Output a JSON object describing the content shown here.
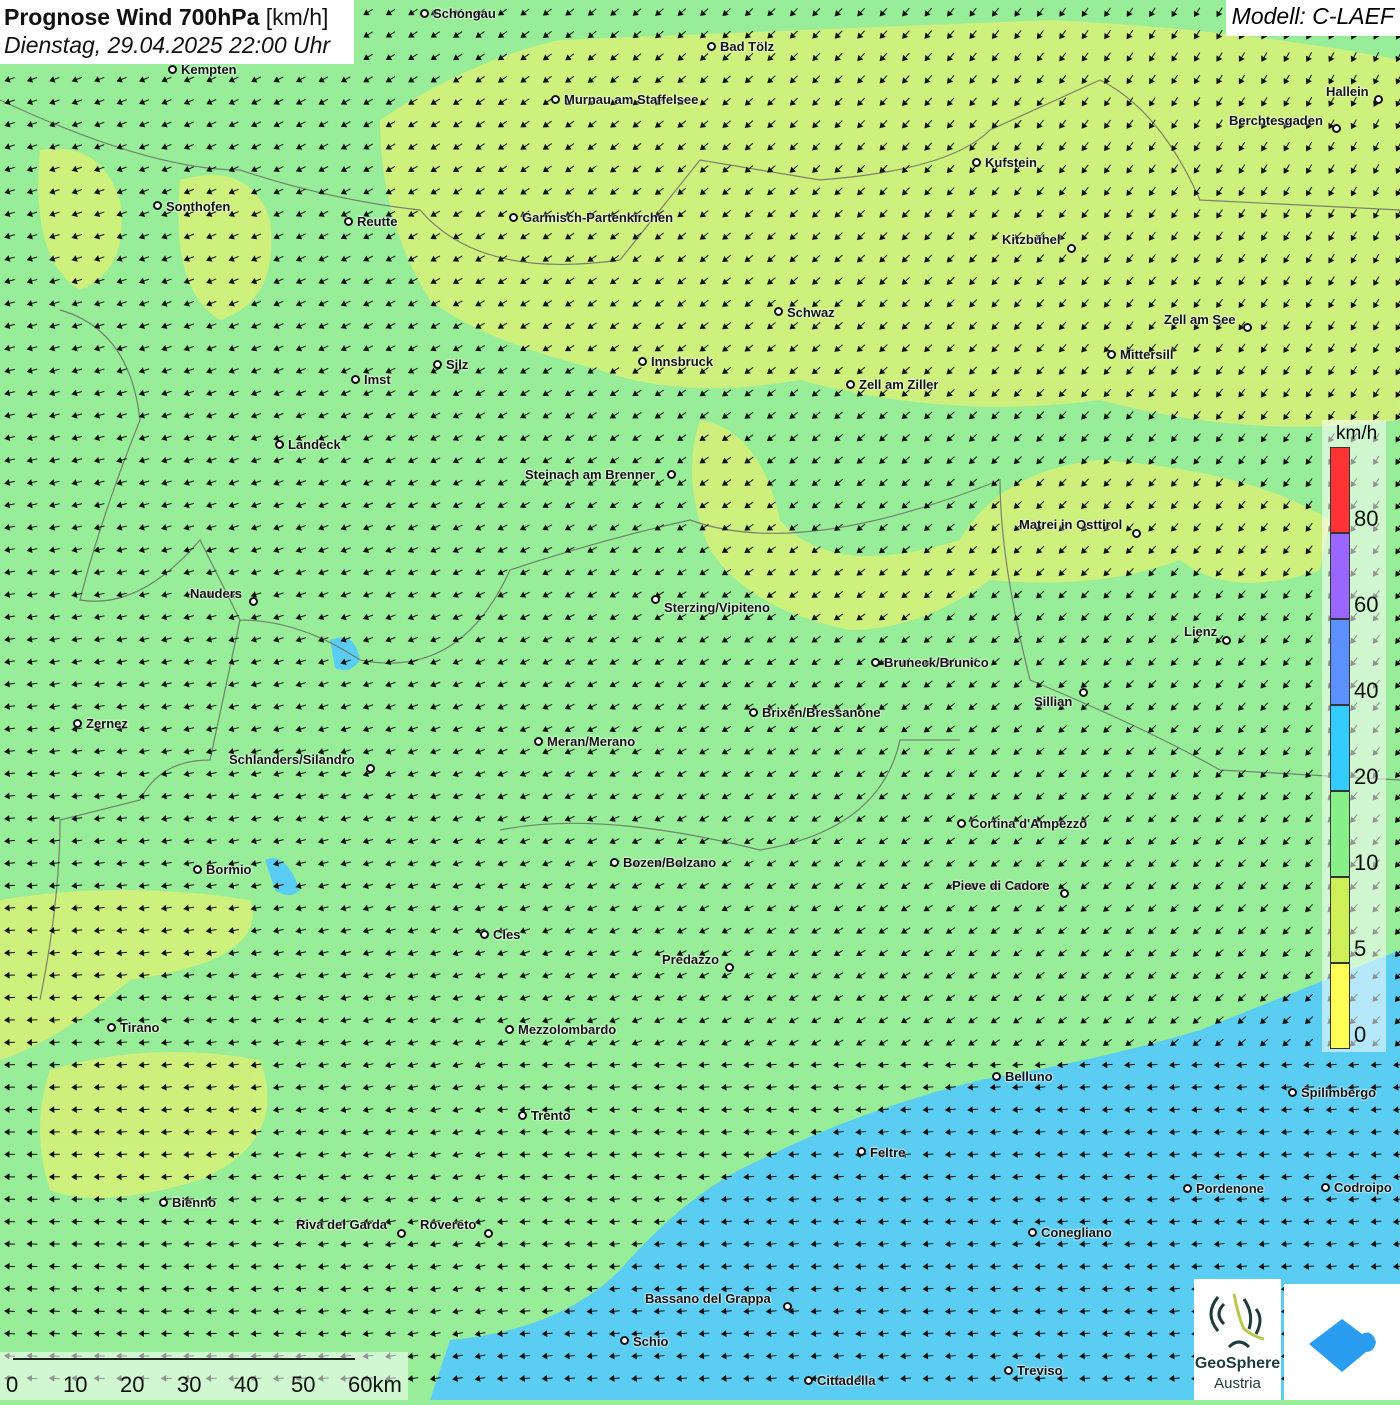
{
  "header": {
    "title_bold": "Prognose Wind 700hPa",
    "title_unit": "[km/h]",
    "datetime": "Dienstag, 29.04.2025 22:00 Uhr"
  },
  "model": "Modell: C-LAEF",
  "legend": {
    "unit": "km/h",
    "labels": [
      "80",
      "60",
      "40",
      "20",
      "10",
      "5",
      "0"
    ],
    "colors": [
      "#ff3333",
      "#9966ff",
      "#5c8fff",
      "#33ccff",
      "#88f088",
      "#ccf055",
      "#ffff55"
    ]
  },
  "scale": {
    "labels": [
      "0",
      "10",
      "20",
      "30",
      "40",
      "50",
      "60km"
    ]
  },
  "logos": {
    "geosphere_line1": "GeoSphere",
    "geosphere_line2": "Austria"
  },
  "map_colors": {
    "green": "#98ee98",
    "yellow_green": "#d4f07a",
    "blue": "#5ccdf2"
  },
  "cities": [
    "Schongau",
    "Bad Tölz",
    "Kempten",
    "Murnau am Staffelsee",
    "Hallein",
    "Berchtesgaden",
    "Kufstein",
    "Sonthofen",
    "Reutte",
    "Garmisch-Partenkirchen",
    "Kitzbühel",
    "Schwaz",
    "Zell am See",
    "Mittersill",
    "Innsbruck",
    "Silz",
    "Imst",
    "Zell am Ziller",
    "Landeck",
    "Steinach am Brenner",
    "Matrei in Osttirol",
    "Nauders",
    "Sterzing/Vipiteno",
    "Lienz",
    "Bruneck/Brunico",
    "Sillian",
    "Brixen/Bressanone",
    "Zernez",
    "Meran/Merano",
    "Schlanders/Silandro",
    "Cortina d'Ampezzo",
    "Bormio",
    "Bozen/Bolzano",
    "Pieve di Cadore",
    "Cles",
    "Predazzo",
    "Tirano",
    "Mezzolombardo",
    "Belluno",
    "Spilimbergo",
    "Trento",
    "Feltre",
    "Bienno",
    "Pordenone",
    "Codroipo",
    "Riva del Garda",
    "Rovereto",
    "Conegliano",
    "Bassano del Grappa",
    "Schio",
    "Treviso",
    "Cittadella"
  ]
}
